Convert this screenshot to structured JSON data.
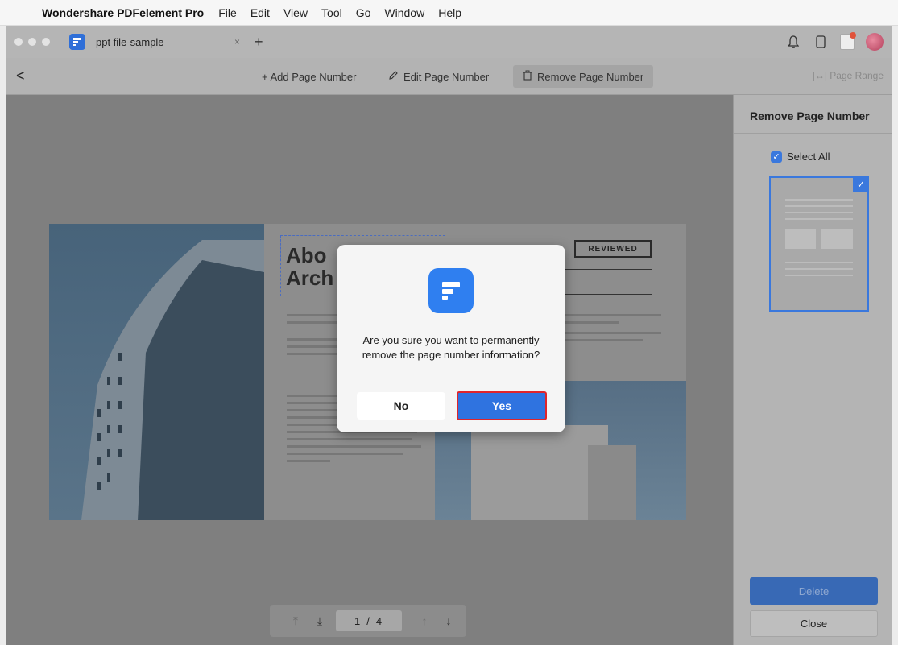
{
  "menubar": {
    "apple_glyph": "",
    "app_name": "Wondershare PDFelement Pro",
    "items": [
      "File",
      "Edit",
      "View",
      "Tool",
      "Go",
      "Window",
      "Help"
    ]
  },
  "tabbar": {
    "doc_tab_title": "ppt file-sample",
    "close_glyph": "×",
    "add_glyph": "+",
    "icons": [
      "bell-icon",
      "device-icon",
      "notification-badge-icon",
      "avatar"
    ]
  },
  "toolbar": {
    "back_glyph": "<",
    "add_label": "+ Add Page Number",
    "edit_label": "Edit Page Number",
    "remove_label": "Remove Page Number",
    "range_label": "|↔| Page Range"
  },
  "document": {
    "heading_line1": "Abo",
    "heading_line2": "Arch",
    "reviewed": "REVIEWED"
  },
  "modal": {
    "message": "Are you sure you want to permanently remove the page number information?",
    "no_label": "No",
    "yes_label": "Yes"
  },
  "pagenav": {
    "current": "1",
    "separator": "/",
    "total": "4"
  },
  "sidebar": {
    "title": "Remove Page Number",
    "select_all": "Select All",
    "delete_label": "Delete",
    "close_label": "Close"
  },
  "colors": {
    "accent": "#2f73e0",
    "highlight_border": "#e0252b"
  }
}
